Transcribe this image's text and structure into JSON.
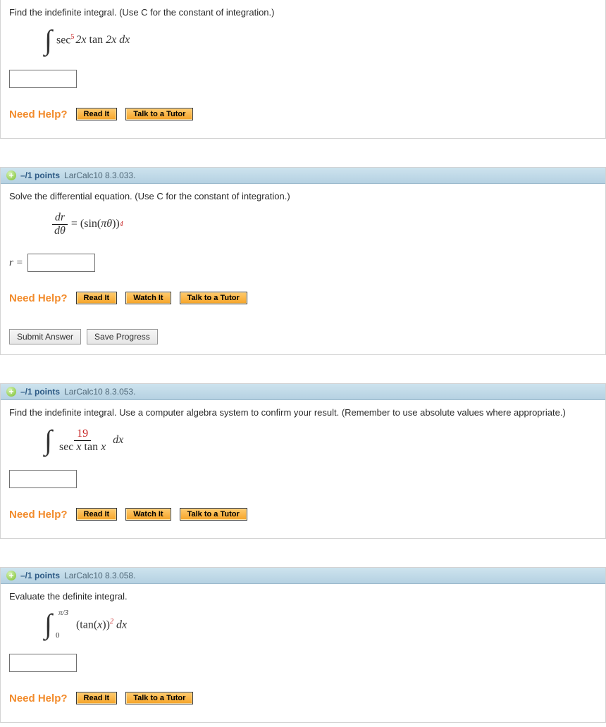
{
  "buttons": {
    "read": "Read It",
    "watch": "Watch It",
    "tutor": "Talk to a Tutor",
    "submit": "Submit Answer",
    "save": "Save Progress"
  },
  "needHelp": "Need Help?",
  "q1": {
    "prompt": "Find the indefinite integral. (Use C for the constant of integration.)",
    "expr_pre": "sec",
    "expr_exp": "5",
    "expr_post": " 2x tan 2x dx"
  },
  "q2": {
    "points": "–/1 points",
    "ref": "LarCalc10 8.3.033.",
    "prompt": "Solve the differential equation. (Use C for the constant of integration.)",
    "lhs_num": "dr",
    "lhs_den": "dθ",
    "rhs_pre": " = (sin(πθ))",
    "rhs_exp": "4",
    "answer_label": "r = "
  },
  "q3": {
    "points": "–/1 points",
    "ref": "LarCalc10 8.3.053.",
    "prompt": "Find the indefinite integral. Use a computer algebra system to confirm your result. (Remember to use absolute values where appropriate.)",
    "num": "19",
    "den": "sec x tan x",
    "dx": " dx"
  },
  "q4": {
    "points": "–/1 points",
    "ref": "LarCalc10 8.3.058.",
    "prompt": "Evaluate the definite integral.",
    "upper": "π/3",
    "lower": "0",
    "integrand_pre": "(tan(x))",
    "integrand_exp": "2",
    "dx": " dx"
  }
}
